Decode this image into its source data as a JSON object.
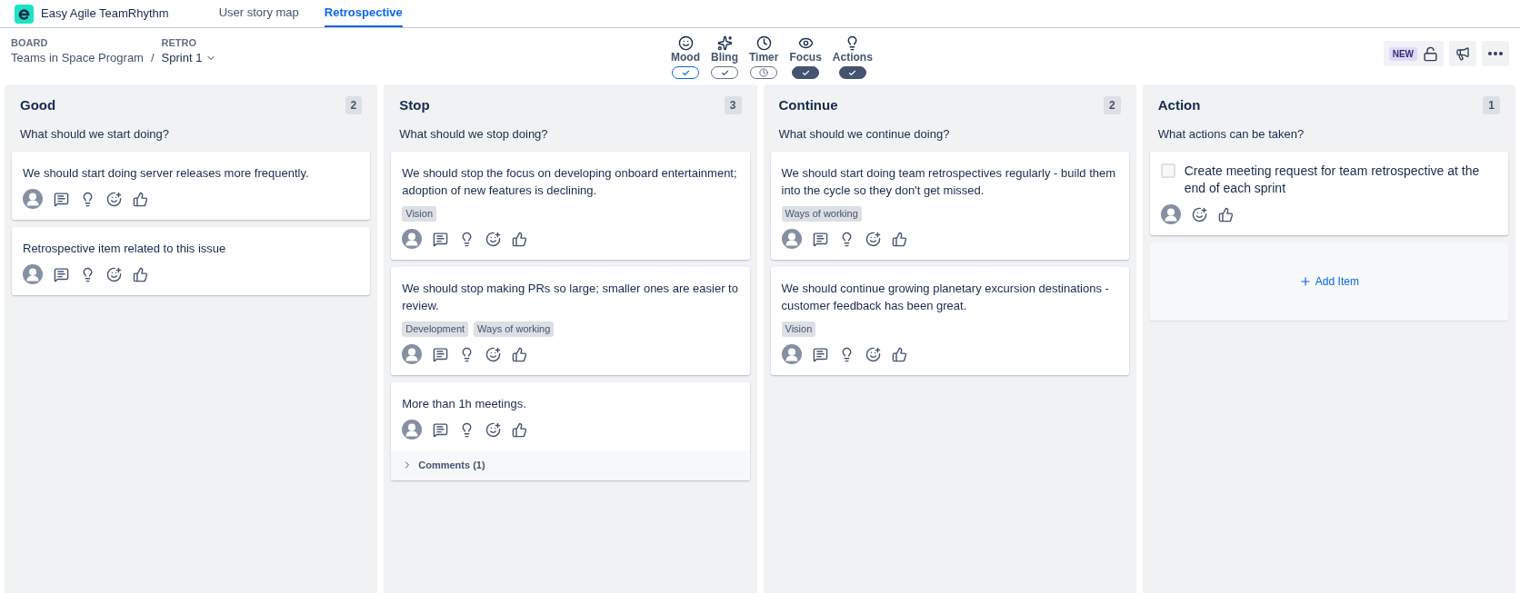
{
  "app": {
    "name": "Easy Agile TeamRhythm"
  },
  "nav_tabs": [
    {
      "label": "User story map",
      "selected": false
    },
    {
      "label": "Retrospective",
      "selected": true
    }
  ],
  "breadcrumb": {
    "board_label": "BOARD",
    "board": "Teams in Space Program",
    "separator": "/",
    "retro_label": "RETRO",
    "retro": "Sprint 1"
  },
  "toggles": [
    {
      "label": "Mood",
      "kind": "check",
      "on": false,
      "selected": true
    },
    {
      "label": "Bling",
      "kind": "check",
      "on": false,
      "selected": false
    },
    {
      "label": "Timer",
      "kind": "clock",
      "on": false,
      "selected": false
    },
    {
      "label": "Focus",
      "kind": "check",
      "on": true,
      "selected": false
    },
    {
      "label": "Actions",
      "kind": "check",
      "on": true,
      "selected": false
    }
  ],
  "toolbar": {
    "badge": "NEW"
  },
  "columns": [
    {
      "title": "Good",
      "count": "2",
      "prompt": "What should we start doing?",
      "cards": [
        {
          "kind": "idea",
          "text": "We should start doing server releases more frequently."
        },
        {
          "kind": "idea",
          "text": "Retrospective item related to this issue"
        }
      ]
    },
    {
      "title": "Stop",
      "count": "3",
      "prompt": "What should we stop doing?",
      "cards": [
        {
          "kind": "idea",
          "text": "We should stop the focus on developing onboard entertainment; adoption of new features is declining.",
          "tags": [
            "Vision"
          ]
        },
        {
          "kind": "idea",
          "text": "We should stop making PRs so large; smaller ones are easier to review.",
          "tags": [
            "Development",
            "Ways of working"
          ]
        },
        {
          "kind": "idea",
          "text": "More than 1h meetings.",
          "comments": {
            "label": "Comments (1)",
            "expanded": false
          }
        }
      ]
    },
    {
      "title": "Continue",
      "count": "2",
      "prompt": "What should we continue doing?",
      "cards": [
        {
          "kind": "idea",
          "text": "We should start doing team retrospectives regularly - build them into the cycle so they don't get missed.",
          "tags": [
            "Ways of working"
          ]
        },
        {
          "kind": "idea",
          "text": "We should continue growing planetary excursion destinations - customer feedback has been great.",
          "tags": [
            "Vision"
          ]
        }
      ]
    },
    {
      "title": "Action",
      "count": "1",
      "prompt": "What actions can be taken?",
      "cards": [
        {
          "kind": "action",
          "text": "Create meeting request for team retrospective at the end of each sprint",
          "checked": false
        }
      ],
      "add_item": "Add Item"
    }
  ]
}
